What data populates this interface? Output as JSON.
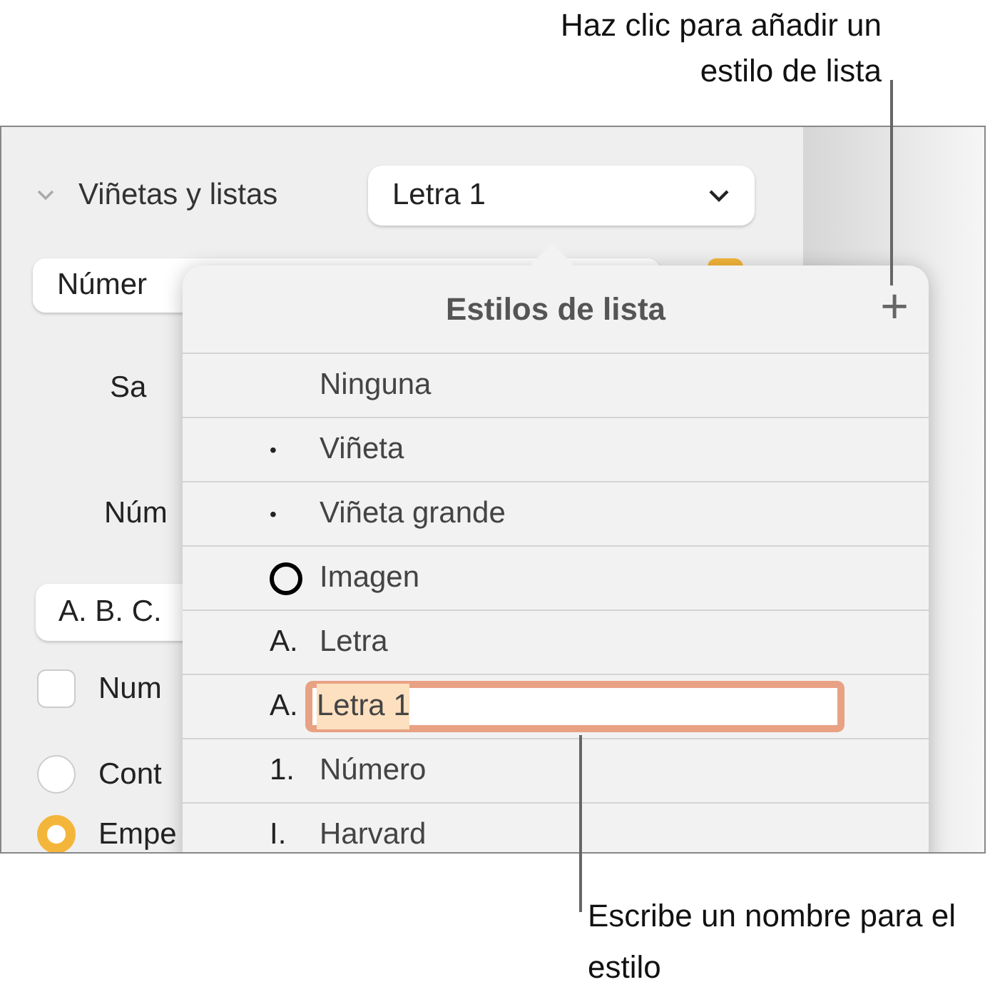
{
  "callouts": [
    {
      "text": "Haz clic para añadir un estilo de lista"
    },
    {
      "text": "Escribe un nombre para el estilo"
    }
  ],
  "sidebar": {
    "section": {
      "label": "Viñetas y listas",
      "expanded": true
    },
    "style_popup": {
      "value": "Letra 1"
    },
    "list_type_popup": {
      "value": "Númer"
    },
    "labels": [
      "Sa",
      "Núm"
    ],
    "format_popup": {
      "value": "A. B. C."
    },
    "checkbox": {
      "label": "Num",
      "checked": false
    },
    "radios": [
      {
        "label": "Cont",
        "selected": false
      },
      {
        "label": "Empe",
        "selected": true
      }
    ]
  },
  "popover": {
    "title": "Estilos de lista",
    "add_button": "+",
    "rows": [
      {
        "kind": "text",
        "marker": "",
        "label": "Ninguna"
      },
      {
        "kind": "text",
        "marker": "•",
        "label": "Viñeta"
      },
      {
        "kind": "text",
        "marker": "•",
        "label": "Viñeta grande"
      },
      {
        "kind": "image",
        "label": "Imagen"
      },
      {
        "kind": "text",
        "marker": "A.",
        "label": "Letra"
      },
      {
        "kind": "editing",
        "marker": "A.",
        "label": "Letra 1"
      },
      {
        "kind": "text",
        "marker": "1.",
        "label": "Número"
      },
      {
        "kind": "text",
        "marker": "I.",
        "label": "Harvard"
      }
    ]
  }
}
